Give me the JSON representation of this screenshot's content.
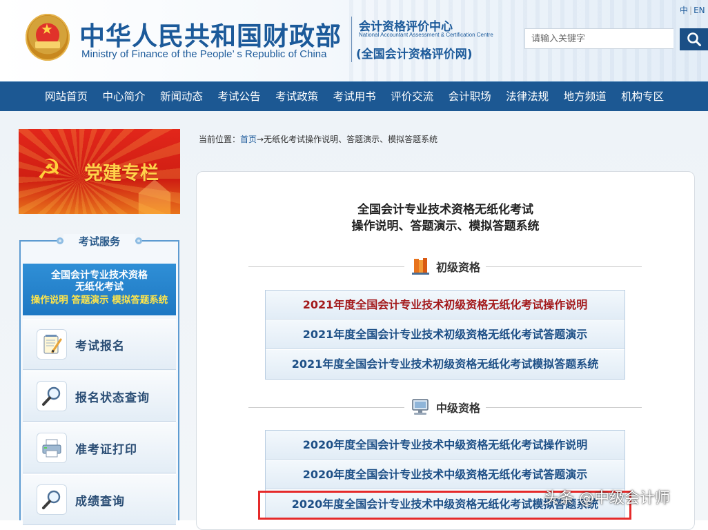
{
  "header": {
    "ministry_cn": "中华人民共和国财政部",
    "ministry_en": "Ministry of Finance of the People’ s Republic of China",
    "center_cn": "会计资格评价中心",
    "center_en": "National Accountant Assessment & Certification Centre",
    "center_site": "(全国会计资格评价网)",
    "lang_cn": "中",
    "lang_sep": "|",
    "lang_en": "EN",
    "search_placeholder": "请输入关键字",
    "emblem_icon": "national-emblem-icon",
    "search_icon": "search-icon"
  },
  "nav": {
    "items": [
      "网站首页",
      "中心简介",
      "新闻动态",
      "考试公告",
      "考试政策",
      "考试用书",
      "评价交流",
      "会计职场",
      "法律法规",
      "地方频道",
      "机构专区"
    ]
  },
  "sidebar": {
    "party_banner": "党建专栏",
    "exam_service_title": "考试服务",
    "promo": {
      "line1": "全国会计专业技术资格",
      "line2": "无纸化考试",
      "line3": "操作说明 答题演示 模拟答题系统"
    },
    "services": [
      {
        "label": "考试报名",
        "icon": "notepad-pencil-icon"
      },
      {
        "label": "报名状态查询",
        "icon": "magnifier-icon"
      },
      {
        "label": "准考证打印",
        "icon": "printer-icon"
      },
      {
        "label": "成绩查询",
        "icon": "magnifier-icon"
      }
    ]
  },
  "breadcrumb": {
    "prefix": "当前位置：",
    "home": "首页",
    "rest": "→无纸化考试操作说明、答题演示、模拟答题系统"
  },
  "main": {
    "title_line1": "全国会计专业技术资格无纸化考试",
    "title_line2": "操作说明、答题演示、模拟答题系统",
    "sections": [
      {
        "title": "初级资格",
        "icon": "books-icon",
        "links": [
          "2021年度全国会计专业技术初级资格无纸化考试操作说明",
          "2021年度全国会计专业技术初级资格无纸化考试答题演示",
          "2021年度全国会计专业技术初级资格无纸化考试模拟答题系统"
        ]
      },
      {
        "title": "中级资格",
        "icon": "computer-icon",
        "links": [
          "2020年度全国会计专业技术中级资格无纸化考试操作说明",
          "2020年度全国会计专业技术中级资格无纸化考试答题演示",
          "2020年度全国会计专业技术中级资格无纸化考试模拟答题系统"
        ]
      }
    ]
  },
  "watermark": "头条 @中级会计师",
  "colors": {
    "brand_blue": "#1c5893",
    "link_blue": "#1d4f86",
    "link_red": "#a3191b",
    "highlight_red": "#e52a2a"
  }
}
